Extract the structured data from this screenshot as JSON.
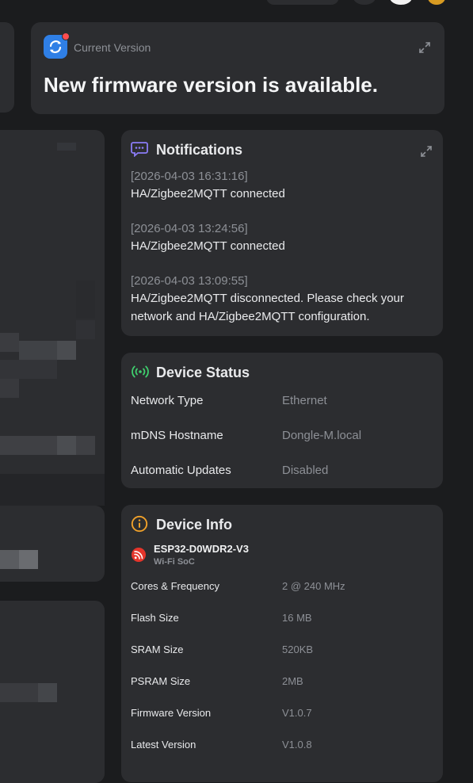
{
  "firmware_card": {
    "label": "Current Version",
    "message": "New firmware version is available."
  },
  "notifications": {
    "title": "Notifications",
    "items": [
      {
        "time": "[2026-04-03 16:31:16]",
        "message": "HA/Zigbee2MQTT connected"
      },
      {
        "time": "[2026-04-03 13:24:56]",
        "message": "HA/Zigbee2MQTT connected"
      },
      {
        "time": "[2026-04-03 13:09:55]",
        "message": "HA/Zigbee2MQTT disconnected. Please check your network and HA/Zigbee2MQTT configuration."
      }
    ]
  },
  "device_status": {
    "title": "Device Status",
    "rows": [
      {
        "label": "Network Type",
        "value": "Ethernet"
      },
      {
        "label": "mDNS Hostname",
        "value": "Dongle-M.local"
      },
      {
        "label": "Automatic Updates",
        "value": "Disabled"
      }
    ]
  },
  "device_info": {
    "title": "Device Info",
    "chip_name": "ESP32-D0WDR2-V3",
    "chip_sub": "Wi-Fi SoC",
    "rows": [
      {
        "label": "Cores & Frequency",
        "value": "2 @ 240 MHz"
      },
      {
        "label": "Flash Size",
        "value": "16 MB"
      },
      {
        "label": "SRAM Size",
        "value": "520KB"
      },
      {
        "label": "PSRAM Size",
        "value": "2MB"
      },
      {
        "label": "Firmware Version",
        "value": "V1.0.7"
      },
      {
        "label": "Latest Version",
        "value": "V1.0.8"
      }
    ]
  },
  "colors": {
    "background": "#1b1c1e",
    "card": "#2c2d30",
    "accent_blue": "#2f7fe6",
    "notification_purple": "#8b7cf6",
    "status_green": "#3fcf6e",
    "info_orange": "#f0a12a",
    "espressif_red": "#e5352b"
  }
}
